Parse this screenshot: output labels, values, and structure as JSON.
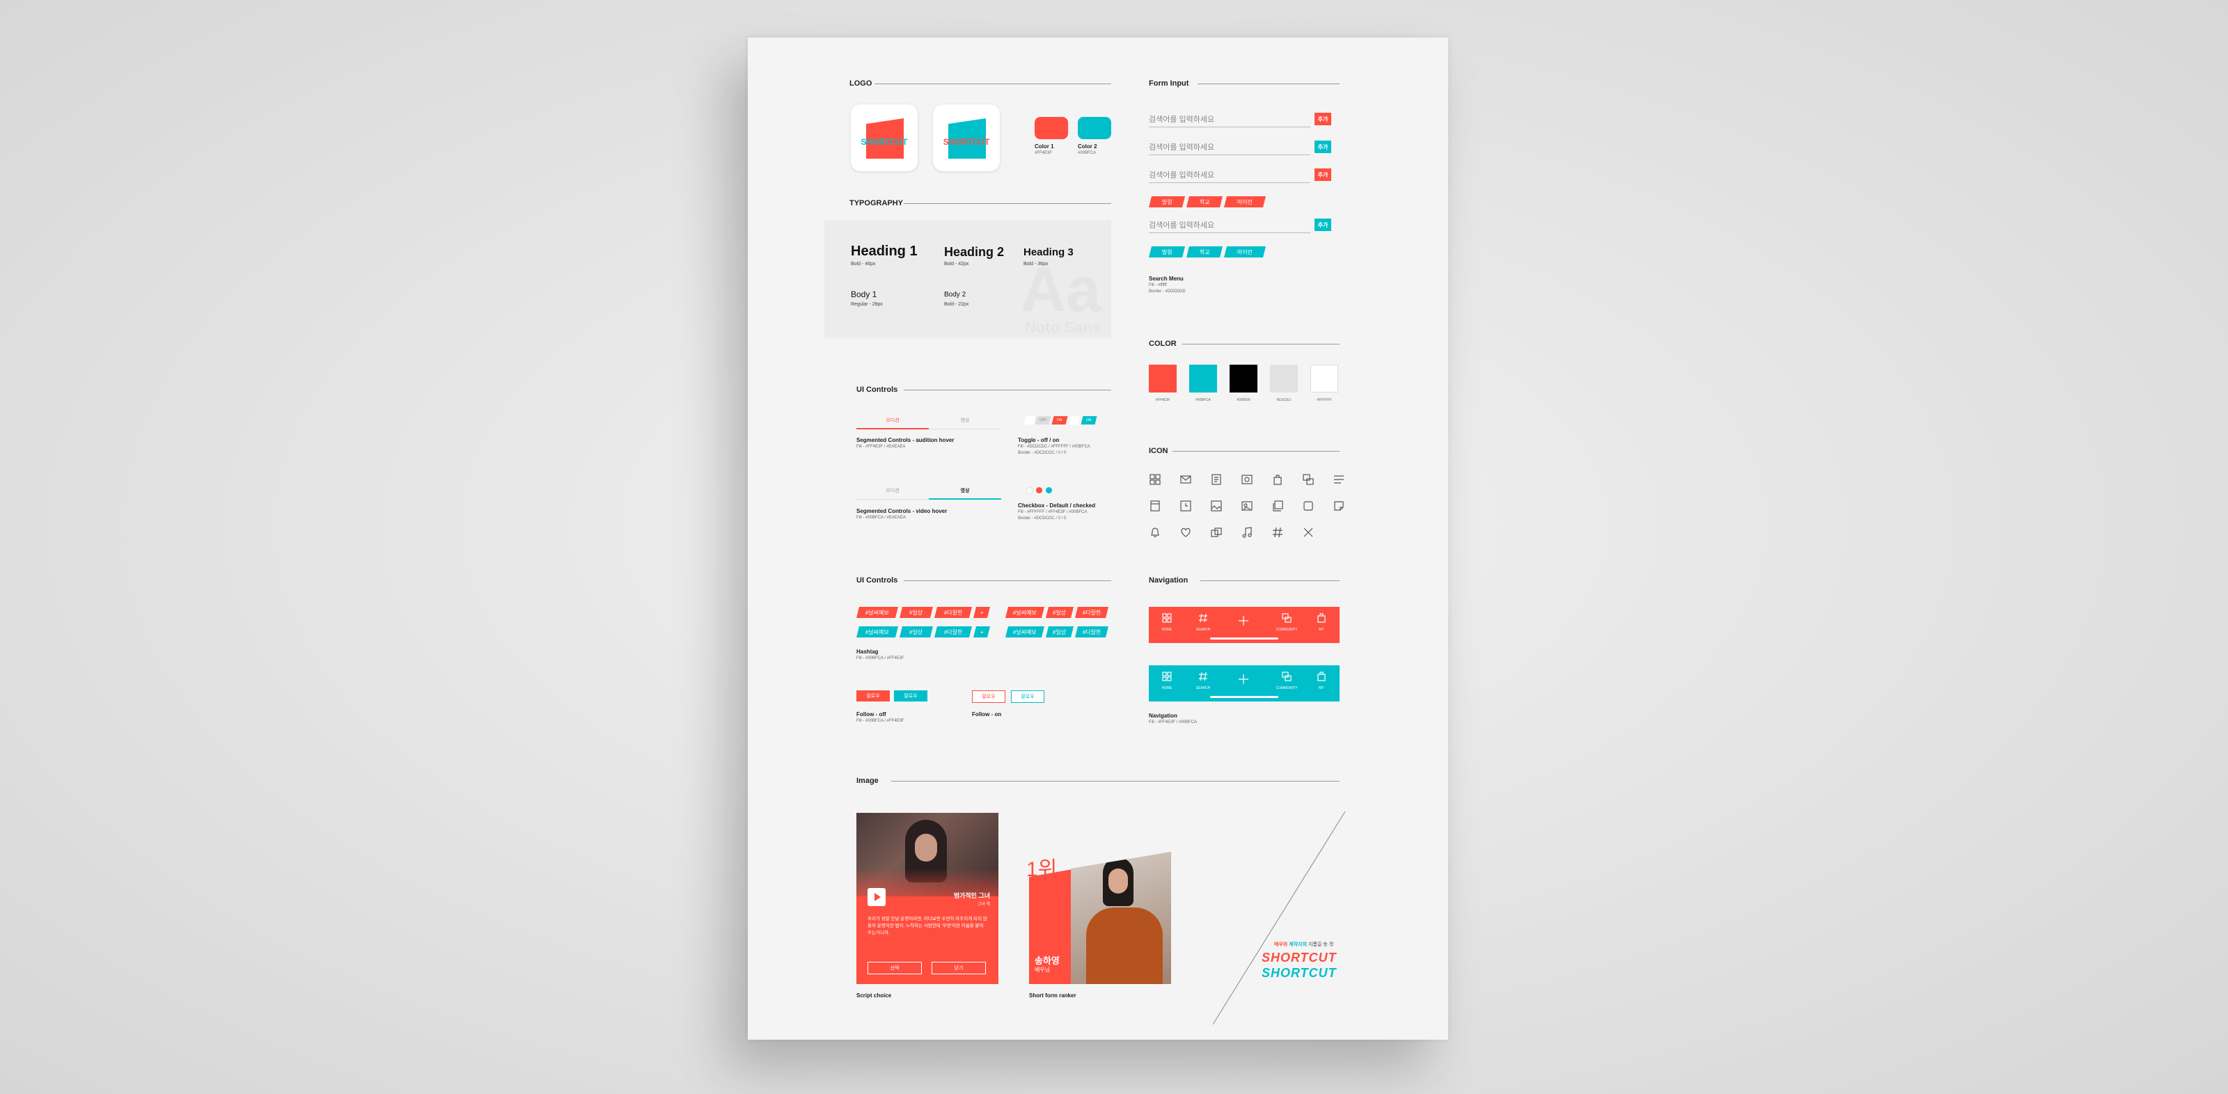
{
  "colors": {
    "coral": "#FF4E3F",
    "teal": "#00BFCA",
    "black": "#000000",
    "lightgray": "#E1E1E1",
    "white": "#FFFFFF"
  },
  "logo": {
    "title": "LOGO",
    "mark_text": "SHORTCUT",
    "color1_label": "Color 1",
    "color1_hex": "#FF4E3F",
    "color2_label": "Color 2",
    "color2_hex": "#00BFCA"
  },
  "typography": {
    "title": "TYPOGRAPHY",
    "h1": "Heading 1",
    "h1_spec": "Bold - 46px",
    "h2": "Heading 2",
    "h2_spec": "Bold - 42px",
    "h3": "Heading 3",
    "h3_spec": "Bold - 36px",
    "b1": "Body 1",
    "b1_spec": "Regular - 28px",
    "b2": "Body 2",
    "b2_spec": "Bold - 22px",
    "aa": "Aa",
    "font_name": "Noto Sans"
  },
  "ui_controls": {
    "title": "UI Controls",
    "seg_a": "오디션",
    "seg_b": "영상",
    "seg1_caption": "Segmented Controls - audition hover",
    "seg1_spec": "Fill - #FF4E3F / #EAEAEA",
    "seg2_caption": "Segmented Controls - video hover",
    "seg2_spec": "Fill - #00BFCA / #EAEAEA",
    "toggle_off": "OFF",
    "toggle_on": "ON",
    "toggle_caption": "Toggle - off / on",
    "toggle_spec1": "Fill - #DCDCDC / #FFFFFF / #00BFCA",
    "toggle_spec2": "Border - #DCDCDC / 0 / 0",
    "check_caption": "Checkbox - Default / checked",
    "check_spec1": "Fill - #FFFFFF / #FF4E3F / #00BFCA",
    "check_spec2": "Border - #DCDCDC / 0 / 0"
  },
  "ui_controls2": {
    "title": "UI Controls",
    "tags": [
      "#날씨예보",
      "#일상",
      "#다잘한",
      "+",
      "#날씨예보",
      "#일상",
      "#다잘한"
    ],
    "hashtag_caption": "Hashtag",
    "hashtag_spec": "Fill - #00BFCA / #FF4E3F",
    "follow_label": "팔로우",
    "follow_off_caption": "Follow - off",
    "follow_off_spec": "Fill - #00BFCA / #FF4E3F",
    "follow_on_caption": "Follow - on"
  },
  "form": {
    "title": "Form Input",
    "placeholder": "검색어를 입력하세요",
    "add": "추가",
    "chips": [
      "발렁",
      "학교",
      "마이린"
    ],
    "caption": "Search Menu",
    "spec1": "Fill - #ffffff",
    "spec2": "Border - #DDDDDD"
  },
  "color": {
    "title": "COLOR",
    "labels": [
      "#FF4E3F",
      "#00BFCA",
      "#000000",
      "#E1E1E1",
      "#FFFFFF"
    ]
  },
  "icon": {
    "title": "ICON",
    "names": [
      "grid-icon",
      "mail-icon",
      "document-icon",
      "gallery-icon",
      "bag-icon",
      "layers-icon",
      "menu-icon",
      "file-icon",
      "clock-file-icon",
      "image-icon",
      "photo-icon",
      "copy-icon",
      "note-icon",
      "bell-icon",
      "heart-icon",
      "duplicate-icon",
      "music-icon",
      "hashtag-icon",
      "close-icon"
    ]
  },
  "navigation": {
    "title": "Navigation",
    "items": [
      "HOME",
      "SEARCH",
      "",
      "COMMUNITY",
      "MY"
    ],
    "caption": "Navigation",
    "spec": "Fill - #FF4E3F / #00BFCA"
  },
  "image": {
    "title": "Image",
    "card1_title": "범가적인 그녀",
    "card1_sub": "그녀 역",
    "card1_body": "우리가 정말 만날 운명이라면, 하다보면 우연히 마주치게 되지 않을까 운명이란 법이, 노력하는 사람한테 '우연'이란 이름을 붙여주는거니까.",
    "card1_btn1": "선택",
    "card1_btn2": "닫기",
    "card1_caption": "Script choice",
    "rank": "1위",
    "actor": "송하영",
    "actor_sub": "배우님",
    "card2_caption": "Short form ranker",
    "tagline_red": "배우와",
    "tagline_teal": "제작자의",
    "tagline_rest": "지름길 숏·컷",
    "brand": "SHORTCUT"
  }
}
